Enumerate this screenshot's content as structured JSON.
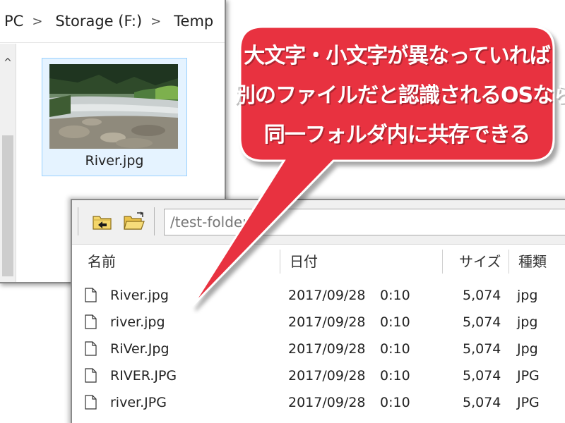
{
  "explorer": {
    "breadcrumb": [
      "PC",
      "Storage (F:)",
      "Temp"
    ],
    "selected_file": {
      "name": "River.jpg"
    }
  },
  "ftp": {
    "path": "/test-folder",
    "columns": {
      "name": "名前",
      "date": "日付",
      "size": "サイズ",
      "type": "種類"
    },
    "files": [
      {
        "name": "River.jpg",
        "date": "2017/09/28",
        "time": "0:10",
        "size": "5,074",
        "type": "jpg"
      },
      {
        "name": "river.jpg",
        "date": "2017/09/28",
        "time": "0:10",
        "size": "5,074",
        "type": "jpg"
      },
      {
        "name": "RiVer.Jpg",
        "date": "2017/09/28",
        "time": "0:10",
        "size": "5,074",
        "type": "Jpg"
      },
      {
        "name": "RIVER.JPG",
        "date": "2017/09/28",
        "time": "0:10",
        "size": "5,074",
        "type": "JPG"
      },
      {
        "name": "river.JPG",
        "date": "2017/09/28",
        "time": "0:10",
        "size": "5,074",
        "type": "JPG"
      }
    ]
  },
  "callout": {
    "lines": [
      "大文字・小文字が異なっていれば",
      "別のファイルだと認識されるOSなら",
      "同一フォルダ内に共存できる"
    ],
    "color": "#e8313f"
  },
  "icons": {
    "toolbar_up": "folder-up-icon",
    "toolbar_open": "open-folder-icon",
    "file": "document-icon",
    "scroll_up": "chevron-up-icon"
  }
}
